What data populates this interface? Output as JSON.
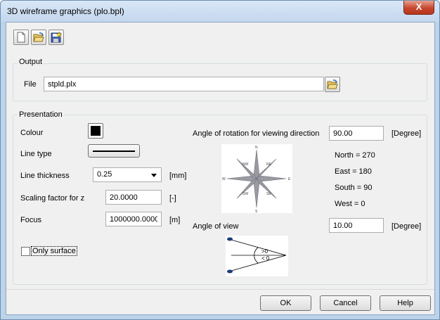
{
  "window": {
    "title": "3D wireframe graphics (plo.bpl)",
    "close_glyph": "X"
  },
  "toolbar": {
    "buttons": [
      {
        "icon": "new-file-icon"
      },
      {
        "icon": "open-folder-icon"
      },
      {
        "icon": "save-icon"
      }
    ]
  },
  "output": {
    "title": "Output",
    "file_label": "File",
    "file_value": "stpld.plx",
    "browse_icon": "open-folder-icon"
  },
  "presentation": {
    "title": "Presentation",
    "colour_label": "Colour",
    "colour_value": "#000000",
    "linetype_label": "Line type",
    "thickness_label": "Line thickness",
    "thickness_value": "0.25",
    "thickness_unit": "[mm]",
    "scaling_label": "Scaling factor for z",
    "scaling_value": "20.0000",
    "scaling_unit": "[-]",
    "focus_label": "Focus",
    "focus_value": "1000000.0000",
    "focus_unit": "[m]",
    "only_surface_label": "Only surface",
    "only_surface_checked": false,
    "rotation_label": "Angle of rotation for viewing direction",
    "rotation_value": "90.00",
    "rotation_unit": "[Degree]",
    "directions": [
      "North = 270",
      "East = 180",
      "South = 90",
      "West = 0"
    ],
    "view_label": "Angle of view",
    "view_value": "10.00",
    "view_unit": "[Degree]",
    "view_diagram": {
      "upper": ">0",
      "lower": "< 0"
    }
  },
  "compass": {
    "n": "N",
    "s": "S",
    "e": "E",
    "w": "W",
    "nw": "NW",
    "ne": "NE",
    "sw": "SW",
    "se": "SE"
  },
  "footer": {
    "ok_label": "OK",
    "cancel_label": "Cancel",
    "help_label": "Help"
  }
}
